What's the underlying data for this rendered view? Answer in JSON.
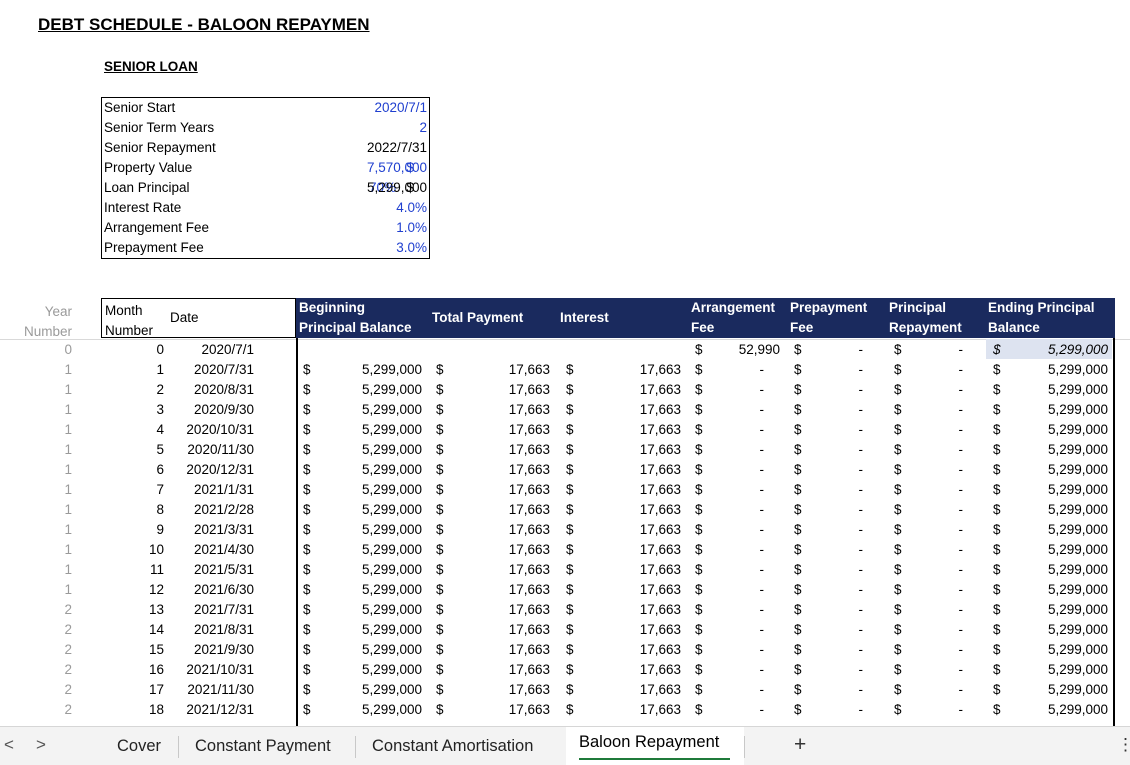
{
  "title": "DEBT SCHEDULE - BALOON REPAYMEN",
  "subtitle": "SENIOR LOAN",
  "params": [
    {
      "label": "Senior Start",
      "pct": "",
      "dollar": "",
      "value": "2020/7/1",
      "blue": true
    },
    {
      "label": "Senior Term Years",
      "pct": "",
      "dollar": "",
      "value": "2",
      "blue": true
    },
    {
      "label": "Senior Repayment",
      "pct": "",
      "dollar": "",
      "value": "2022/7/31",
      "blue": false
    },
    {
      "label": "Property Value",
      "pct": "",
      "dollar": "$",
      "value": "7,570,000",
      "blue": true
    },
    {
      "label": "Loan Principal",
      "pct": "70%",
      "dollar": "$",
      "value": "5,299,000",
      "blue": false
    },
    {
      "label": "Interest Rate",
      "pct": "",
      "dollar": "",
      "value": "4.0%",
      "blue": true
    },
    {
      "label": "Arrangement Fee",
      "pct": "",
      "dollar": "",
      "value": "1.0%",
      "blue": true
    },
    {
      "label": "Prepayment Fee",
      "pct": "",
      "dollar": "",
      "value": "3.0%",
      "blue": true
    }
  ],
  "table": {
    "headers": {
      "year": [
        "Year",
        "Number"
      ],
      "month": [
        "Month",
        "Number"
      ],
      "date": "Date",
      "beginning": [
        "Beginning",
        "Principal Balance"
      ],
      "total_payment": "Total Payment",
      "interest": "Interest",
      "arrangement": [
        "Arrangement",
        "Fee"
      ],
      "prepayment": [
        "Prepayment",
        "Fee"
      ],
      "principal": [
        "Principal",
        "Repayment"
      ],
      "ending": [
        "Ending Principal",
        "Balance"
      ]
    },
    "rows": [
      {
        "year": "0",
        "num": "0",
        "date": "2020/7/1",
        "beg": "",
        "tp": "",
        "int": "",
        "arr": "52,990",
        "pre": "-",
        "prin": "-",
        "end": "5,299,000"
      },
      {
        "year": "1",
        "num": "1",
        "date": "2020/7/31",
        "beg": "5,299,000",
        "tp": "17,663",
        "int": "17,663",
        "arr": "-",
        "pre": "-",
        "prin": "-",
        "end": "5,299,000"
      },
      {
        "year": "1",
        "num": "2",
        "date": "2020/8/31",
        "beg": "5,299,000",
        "tp": "17,663",
        "int": "17,663",
        "arr": "-",
        "pre": "-",
        "prin": "-",
        "end": "5,299,000"
      },
      {
        "year": "1",
        "num": "3",
        "date": "2020/9/30",
        "beg": "5,299,000",
        "tp": "17,663",
        "int": "17,663",
        "arr": "-",
        "pre": "-",
        "prin": "-",
        "end": "5,299,000"
      },
      {
        "year": "1",
        "num": "4",
        "date": "2020/10/31",
        "beg": "5,299,000",
        "tp": "17,663",
        "int": "17,663",
        "arr": "-",
        "pre": "-",
        "prin": "-",
        "end": "5,299,000"
      },
      {
        "year": "1",
        "num": "5",
        "date": "2020/11/30",
        "beg": "5,299,000",
        "tp": "17,663",
        "int": "17,663",
        "arr": "-",
        "pre": "-",
        "prin": "-",
        "end": "5,299,000"
      },
      {
        "year": "1",
        "num": "6",
        "date": "2020/12/31",
        "beg": "5,299,000",
        "tp": "17,663",
        "int": "17,663",
        "arr": "-",
        "pre": "-",
        "prin": "-",
        "end": "5,299,000"
      },
      {
        "year": "1",
        "num": "7",
        "date": "2021/1/31",
        "beg": "5,299,000",
        "tp": "17,663",
        "int": "17,663",
        "arr": "-",
        "pre": "-",
        "prin": "-",
        "end": "5,299,000"
      },
      {
        "year": "1",
        "num": "8",
        "date": "2021/2/28",
        "beg": "5,299,000",
        "tp": "17,663",
        "int": "17,663",
        "arr": "-",
        "pre": "-",
        "prin": "-",
        "end": "5,299,000"
      },
      {
        "year": "1",
        "num": "9",
        "date": "2021/3/31",
        "beg": "5,299,000",
        "tp": "17,663",
        "int": "17,663",
        "arr": "-",
        "pre": "-",
        "prin": "-",
        "end": "5,299,000"
      },
      {
        "year": "1",
        "num": "10",
        "date": "2021/4/30",
        "beg": "5,299,000",
        "tp": "17,663",
        "int": "17,663",
        "arr": "-",
        "pre": "-",
        "prin": "-",
        "end": "5,299,000"
      },
      {
        "year": "1",
        "num": "11",
        "date": "2021/5/31",
        "beg": "5,299,000",
        "tp": "17,663",
        "int": "17,663",
        "arr": "-",
        "pre": "-",
        "prin": "-",
        "end": "5,299,000"
      },
      {
        "year": "1",
        "num": "12",
        "date": "2021/6/30",
        "beg": "5,299,000",
        "tp": "17,663",
        "int": "17,663",
        "arr": "-",
        "pre": "-",
        "prin": "-",
        "end": "5,299,000"
      },
      {
        "year": "2",
        "num": "13",
        "date": "2021/7/31",
        "beg": "5,299,000",
        "tp": "17,663",
        "int": "17,663",
        "arr": "-",
        "pre": "-",
        "prin": "-",
        "end": "5,299,000"
      },
      {
        "year": "2",
        "num": "14",
        "date": "2021/8/31",
        "beg": "5,299,000",
        "tp": "17,663",
        "int": "17,663",
        "arr": "-",
        "pre": "-",
        "prin": "-",
        "end": "5,299,000"
      },
      {
        "year": "2",
        "num": "15",
        "date": "2021/9/30",
        "beg": "5,299,000",
        "tp": "17,663",
        "int": "17,663",
        "arr": "-",
        "pre": "-",
        "prin": "-",
        "end": "5,299,000"
      },
      {
        "year": "2",
        "num": "16",
        "date": "2021/10/31",
        "beg": "5,299,000",
        "tp": "17,663",
        "int": "17,663",
        "arr": "-",
        "pre": "-",
        "prin": "-",
        "end": "5,299,000"
      },
      {
        "year": "2",
        "num": "17",
        "date": "2021/11/30",
        "beg": "5,299,000",
        "tp": "17,663",
        "int": "17,663",
        "arr": "-",
        "pre": "-",
        "prin": "-",
        "end": "5,299,000"
      },
      {
        "year": "2",
        "num": "18",
        "date": "2021/12/31",
        "beg": "5,299,000",
        "tp": "17,663",
        "int": "17,663",
        "arr": "-",
        "pre": "-",
        "prin": "-",
        "end": "5,299,000"
      }
    ]
  },
  "sheet_tabs": [
    "Cover",
    "Constant Payment",
    "Constant Amortisation",
    "Baloon Repayment"
  ],
  "active_tab": "Baloon Repayment",
  "nav": {
    "prev": "<",
    "next": ">",
    "add": "+",
    "more": "⋮"
  },
  "colors": {
    "header_navy": "#1a2a5e",
    "input_blue": "#1f3fcf",
    "tab_underline": "#1f7a3a"
  }
}
